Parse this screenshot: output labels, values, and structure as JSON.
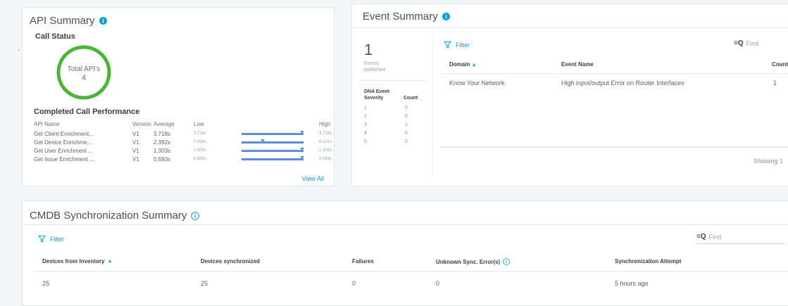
{
  "api_summary": {
    "title": "API Summary",
    "call_status": {
      "title": "Call Status",
      "total_label": "Total API's",
      "total_value": "4",
      "ring_color": "#48b534"
    },
    "performance": {
      "title": "Completed Call Performance",
      "headers": {
        "api_name": "API Name",
        "version": "Version",
        "average": "Average",
        "low": "Low",
        "high": "High"
      },
      "rows": [
        {
          "name": "Get Client Enrichment...",
          "version": "V1",
          "average": "3.718s",
          "low": "3.718s",
          "high": "3.718s",
          "avg_fraction": 0.98
        },
        {
          "name": "Get Device Enrichme...",
          "version": "V1",
          "average": "2.392s",
          "low": "0.458s",
          "high": "6.101s",
          "avg_fraction": 0.34
        },
        {
          "name": "Get User Enrichment ...",
          "version": "V1",
          "average": "1.303s",
          "low": "1.303s",
          "high": "1.303s",
          "avg_fraction": 0.98
        },
        {
          "name": "Get Issue Enrichment ...",
          "version": "V1",
          "average": "0.693s",
          "low": "0.693s",
          "high": "0.693s",
          "avg_fraction": 0.98
        }
      ]
    },
    "view_all": "View All"
  },
  "event_summary": {
    "title": "Event Summary",
    "events_published": {
      "value": "1",
      "label_line1": "Events",
      "label_line2": "published"
    },
    "severity": {
      "header_line1": "DNA Event",
      "header_line2": "Severity",
      "count_header": "Count",
      "rows": [
        {
          "severity": "1",
          "count": "0"
        },
        {
          "severity": "2",
          "count": "0"
        },
        {
          "severity": "3",
          "count": "1"
        },
        {
          "severity": "4",
          "count": "0"
        },
        {
          "severity": "5",
          "count": "0"
        }
      ]
    },
    "filter_label": "Filter",
    "find_placeholder": "Find",
    "table": {
      "headers": {
        "domain": "Domain",
        "event_name": "Event Name",
        "count": "Count"
      },
      "rows": [
        {
          "domain": "Know Your Network",
          "event_name": "High input/output Error on Router Interfaces",
          "count": "1"
        }
      ]
    },
    "showing": "Showing 1"
  },
  "cmdb": {
    "title": "CMDB Synchronization Summary",
    "filter_label": "Filter",
    "find_placeholder": "Find",
    "headers": {
      "devices_inventory": "Devices from Inventory",
      "devices_synced": "Devices synchronized",
      "failures": "Failures",
      "unknown_errors": "Unknown Sync. Error(s)",
      "sync_attempt": "Synchronization Attempt"
    },
    "row": {
      "devices_inventory": "25",
      "devices_synced": "25",
      "failures": "0",
      "unknown_errors": "0",
      "sync_attempt": "5 hours ago"
    }
  },
  "colors": {
    "accent": "#049fd9",
    "bar": "#5a8fd8",
    "ok": "#48b534"
  }
}
